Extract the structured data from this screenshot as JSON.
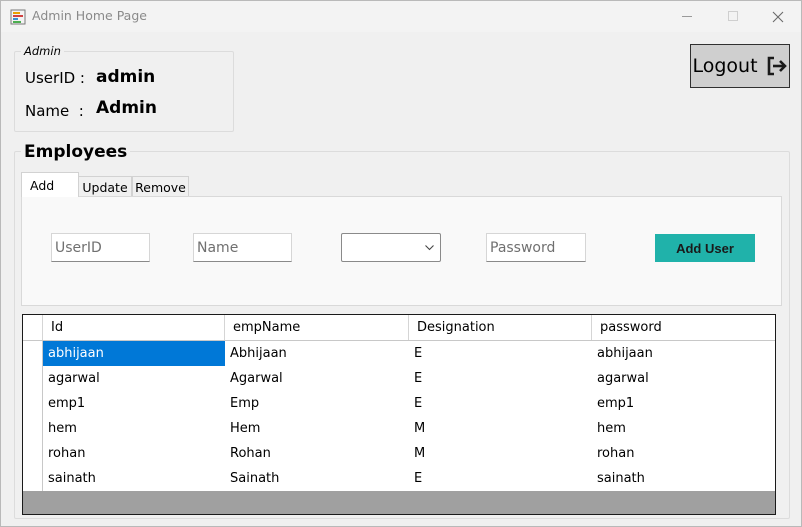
{
  "window": {
    "title": "Admin Home Page"
  },
  "admin": {
    "legend": "Admin",
    "userid_label": "UserID :",
    "userid_value": "admin",
    "name_label": "Name  :",
    "name_value": "Admin"
  },
  "logout": {
    "label": "Logout"
  },
  "employees": {
    "legend": "Employees",
    "tabs": [
      {
        "label": "Add"
      },
      {
        "label": "Update"
      },
      {
        "label": "Remove"
      }
    ],
    "form": {
      "userid_placeholder": "UserID",
      "name_placeholder": "Name",
      "designation_value": "",
      "password_placeholder": "Password",
      "add_button": "Add User"
    },
    "grid": {
      "columns": [
        "Id",
        "empName",
        "Designation",
        "password"
      ],
      "rows": [
        [
          "abhijaan",
          "Abhijaan",
          "E",
          "abhijaan"
        ],
        [
          "agarwal",
          "Agarwal",
          "E",
          "agarwal"
        ],
        [
          "emp1",
          "Emp",
          "E",
          "emp1"
        ],
        [
          "hem",
          "Hem",
          "M",
          "hem"
        ],
        [
          "rohan",
          "Rohan",
          "M",
          "rohan"
        ],
        [
          "sainath",
          "Sainath",
          "E",
          "sainath"
        ]
      ]
    }
  },
  "colors": {
    "accent": "#20b2aa",
    "selection": "#0078d7"
  }
}
